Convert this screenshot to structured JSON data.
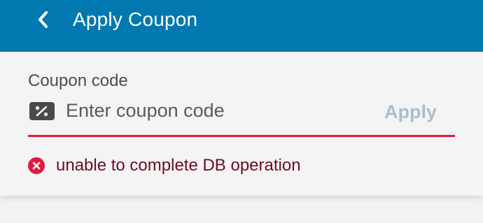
{
  "header": {
    "title": "Apply Coupon",
    "background": "#0178b0",
    "back_icon": "chevron-left-icon"
  },
  "coupon_form": {
    "label": "Coupon code",
    "input": {
      "value": "",
      "placeholder": "Enter coupon code",
      "icon": "percent-tag-icon"
    },
    "apply_label": "Apply",
    "apply_color": "#a9bfcc",
    "underline_color": "#e5193d"
  },
  "error": {
    "icon": "error-circle-icon",
    "message": "unable to complete DB operation",
    "color": "#e5193d"
  }
}
